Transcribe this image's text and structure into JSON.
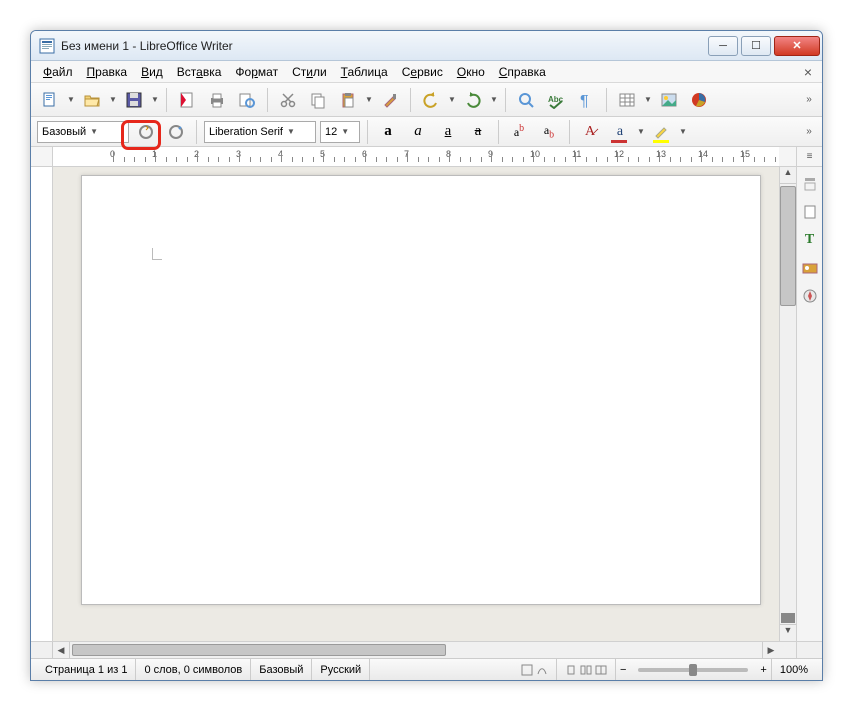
{
  "window": {
    "title": "Без имени 1 - LibreOffice Writer"
  },
  "menu": [
    "Файл",
    "Правка",
    "Вид",
    "Вставка",
    "Формат",
    "Стили",
    "Таблица",
    "Сервис",
    "Окно",
    "Справка"
  ],
  "toolbar1": {
    "items": [
      {
        "n": "new-document",
        "icon": "doc",
        "drop": true
      },
      {
        "n": "open",
        "icon": "folder",
        "drop": true,
        "highlighted": true
      },
      {
        "n": "save",
        "icon": "disk",
        "drop": true
      },
      {
        "sep": true
      },
      {
        "n": "export-pdf",
        "icon": "pdf"
      },
      {
        "n": "print",
        "icon": "printer"
      },
      {
        "n": "print-preview",
        "icon": "preview"
      },
      {
        "sep": true
      },
      {
        "n": "cut",
        "icon": "scissors"
      },
      {
        "n": "copy",
        "icon": "copy"
      },
      {
        "n": "paste",
        "icon": "paste",
        "drop": true
      },
      {
        "n": "clone-formatting",
        "icon": "brush"
      },
      {
        "sep": true
      },
      {
        "n": "undo",
        "icon": "undo",
        "drop": true
      },
      {
        "n": "redo",
        "icon": "redo",
        "drop": true
      },
      {
        "sep": true
      },
      {
        "n": "find",
        "icon": "find"
      },
      {
        "n": "spellcheck",
        "icon": "abc"
      },
      {
        "n": "formatting-marks",
        "icon": "pilcrow"
      },
      {
        "sep": true
      },
      {
        "n": "insert-table",
        "icon": "table",
        "drop": true
      },
      {
        "n": "insert-image",
        "icon": "image"
      },
      {
        "n": "insert-chart",
        "icon": "chart"
      }
    ]
  },
  "formatbar": {
    "paragraph_style": "Базовый",
    "font_name": "Liberation Serif",
    "font_size": "12"
  },
  "ruler": {
    "max": 17
  },
  "sidepanel": [
    "menu",
    "properties",
    "page",
    "styles",
    "gallery",
    "navigator"
  ],
  "statusbar": {
    "page": "Страница 1 из 1",
    "words": "0 слов, 0 символов",
    "style": "Базовый",
    "language": "Русский",
    "zoom": "100%"
  }
}
